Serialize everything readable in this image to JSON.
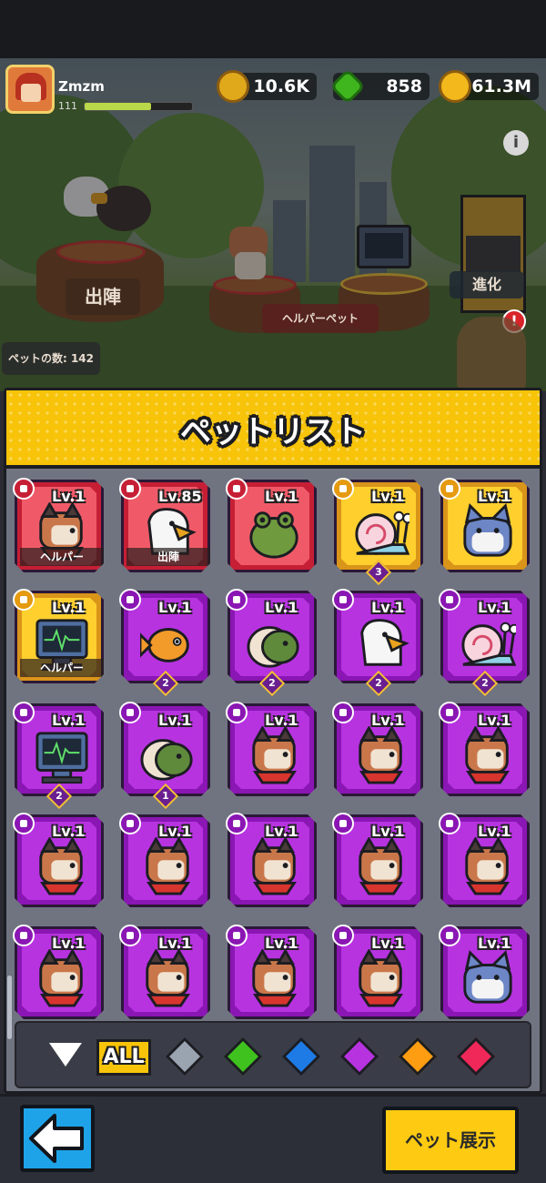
{
  "player": {
    "name": "Zmzm",
    "level": "111"
  },
  "resources": {
    "gold": "10.6K",
    "gems": "858",
    "coins": "61.3M"
  },
  "scene": {
    "deploy_label": "出陣",
    "helper_pet_label": "ヘルパーペット",
    "evolve_label": "進化",
    "pet_count_label": "ペットの数: 142"
  },
  "panel": {
    "title": "ペットリスト"
  },
  "pets": [
    {
      "rarity": "red",
      "icon": "dog",
      "level": "Lv.1",
      "tag": "ヘルパー",
      "stars": ""
    },
    {
      "rarity": "red",
      "icon": "eagle",
      "level": "Lv.85",
      "tag": "出陣",
      "stars": ""
    },
    {
      "rarity": "red",
      "icon": "frog",
      "level": "Lv.1",
      "tag": "",
      "stars": ""
    },
    {
      "rarity": "gold",
      "icon": "snail",
      "level": "Lv.1",
      "tag": "",
      "stars": "3"
    },
    {
      "rarity": "gold",
      "icon": "cat",
      "level": "Lv.1",
      "tag": "",
      "stars": ""
    },
    {
      "rarity": "gold",
      "icon": "monitor",
      "level": "Lv.1",
      "tag": "ヘルパー",
      "stars": ""
    },
    {
      "rarity": "purple",
      "icon": "goldfish",
      "level": "Lv.1",
      "tag": "",
      "stars": "2"
    },
    {
      "rarity": "purple",
      "icon": "turtle",
      "level": "Lv.1",
      "tag": "",
      "stars": "2"
    },
    {
      "rarity": "purple",
      "icon": "eagle",
      "level": "Lv.1",
      "tag": "",
      "stars": "2"
    },
    {
      "rarity": "purple",
      "icon": "snail",
      "level": "Lv.1",
      "tag": "",
      "stars": "2"
    },
    {
      "rarity": "purple",
      "icon": "monitor",
      "level": "Lv.1",
      "tag": "",
      "stars": "2"
    },
    {
      "rarity": "purple",
      "icon": "turtle",
      "level": "Lv.1",
      "tag": "",
      "stars": "1"
    },
    {
      "rarity": "purple",
      "icon": "dog",
      "level": "Lv.1",
      "tag": "",
      "stars": ""
    },
    {
      "rarity": "purple",
      "icon": "dog",
      "level": "Lv.1",
      "tag": "",
      "stars": ""
    },
    {
      "rarity": "purple",
      "icon": "dog",
      "level": "Lv.1",
      "tag": "",
      "stars": ""
    },
    {
      "rarity": "purple",
      "icon": "dog",
      "level": "Lv.1",
      "tag": "",
      "stars": ""
    },
    {
      "rarity": "purple",
      "icon": "dog",
      "level": "Lv.1",
      "tag": "",
      "stars": ""
    },
    {
      "rarity": "purple",
      "icon": "dog",
      "level": "Lv.1",
      "tag": "",
      "stars": ""
    },
    {
      "rarity": "purple",
      "icon": "dog",
      "level": "Lv.1",
      "tag": "",
      "stars": ""
    },
    {
      "rarity": "purple",
      "icon": "dog",
      "level": "Lv.1",
      "tag": "",
      "stars": ""
    },
    {
      "rarity": "purple",
      "icon": "dog",
      "level": "Lv.1",
      "tag": "",
      "stars": ""
    },
    {
      "rarity": "purple",
      "icon": "dog",
      "level": "Lv.1",
      "tag": "",
      "stars": ""
    },
    {
      "rarity": "purple",
      "icon": "dog",
      "level": "Lv.1",
      "tag": "",
      "stars": ""
    },
    {
      "rarity": "purple",
      "icon": "dog",
      "level": "Lv.1",
      "tag": "",
      "stars": ""
    },
    {
      "rarity": "purple",
      "icon": "cat",
      "level": "Lv.1",
      "tag": "",
      "stars": ""
    }
  ],
  "filters": {
    "all_label": "ALL",
    "colors": [
      "#9aa3b0",
      "#3fc21e",
      "#1e7be6",
      "#b733e0",
      "#ff9d12",
      "#f0285a"
    ]
  },
  "footer": {
    "show_label": "ペット展示"
  }
}
